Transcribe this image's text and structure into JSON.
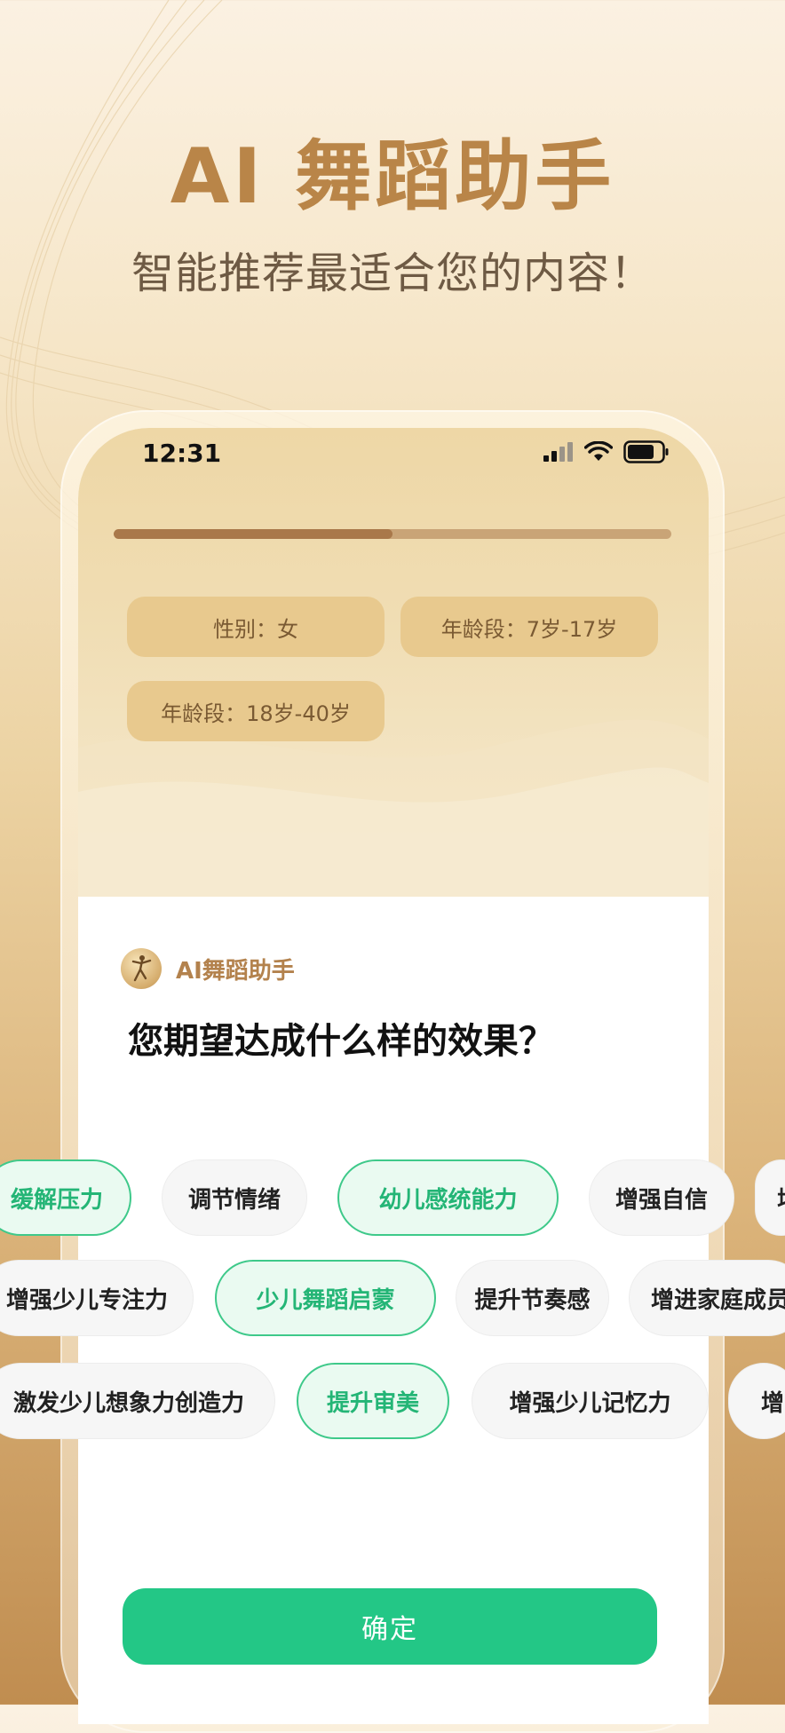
{
  "hero": {
    "title": "AI 舞蹈助手",
    "subtitle": "智能推荐最适合您的内容！"
  },
  "status_bar": {
    "time": "12:31",
    "icons": [
      "signal-icon",
      "wifi-icon",
      "battery-icon"
    ]
  },
  "progress": {
    "fraction": 0.5
  },
  "selections": {
    "gender": "性别：女",
    "age_1": "年龄段：7岁-17岁",
    "age_2": "年龄段：18岁-40岁"
  },
  "assistant": {
    "name": "AI舞蹈助手",
    "question": "您期望达成什么样的效果？"
  },
  "options": [
    {
      "label": "缓解压力",
      "selected": true
    },
    {
      "label": "调节情绪",
      "selected": false
    },
    {
      "label": "幼儿感统能力",
      "selected": true
    },
    {
      "label": "增强自信",
      "selected": false
    },
    {
      "label": "增",
      "selected": false
    },
    {
      "label": "增强少儿专注力",
      "selected": false
    },
    {
      "label": "少儿舞蹈启蒙",
      "selected": true
    },
    {
      "label": "提升节奏感",
      "selected": false
    },
    {
      "label": "增进家庭成员",
      "selected": false
    },
    {
      "label": "激发少儿想象力创造力",
      "selected": false
    },
    {
      "label": "提升审美",
      "selected": true
    },
    {
      "label": "增强少儿记忆力",
      "selected": false
    },
    {
      "label": "增",
      "selected": false
    }
  ],
  "confirm_label": "确定",
  "colors": {
    "accent_green": "#23c786",
    "selected_text": "#24b576",
    "title_gold": "#b98548"
  }
}
